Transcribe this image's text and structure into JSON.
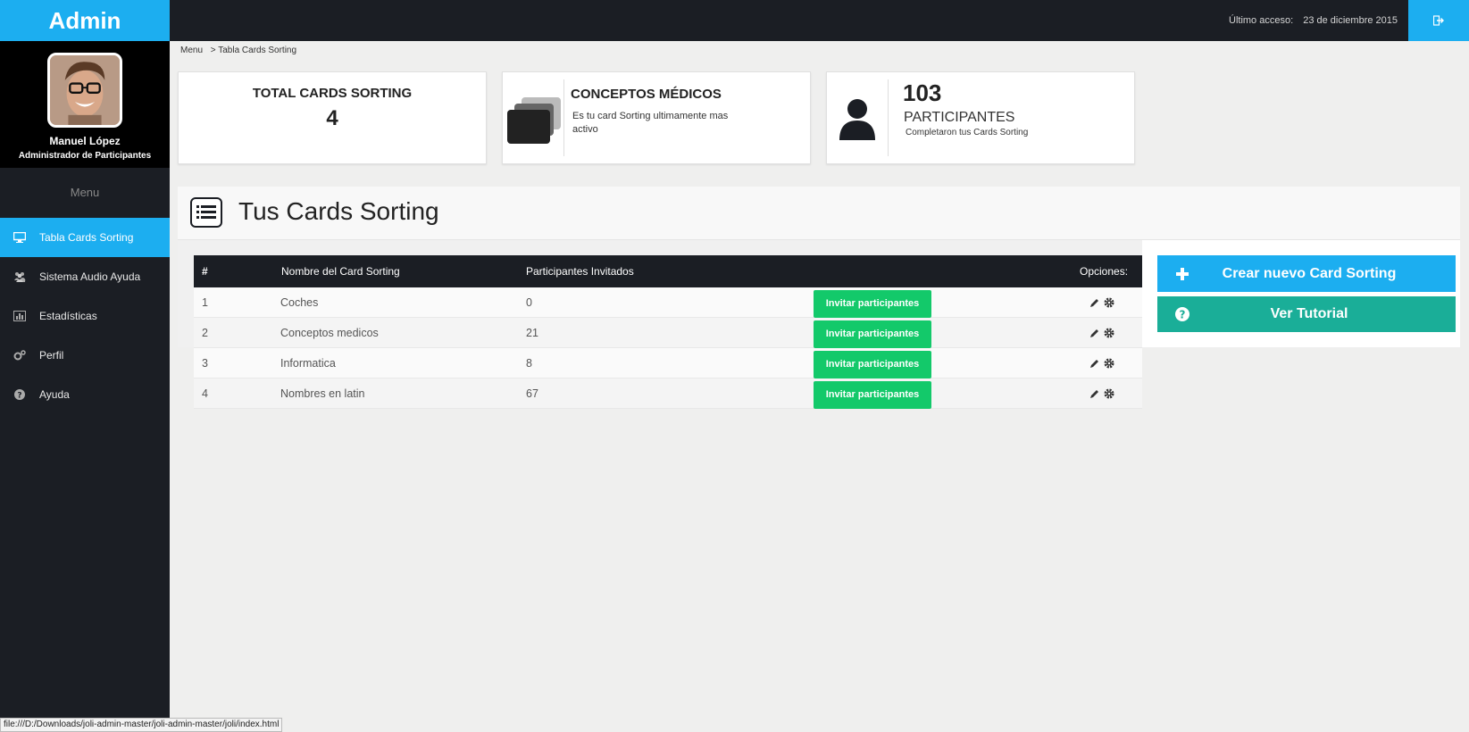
{
  "app": {
    "brand": "Admin"
  },
  "profile": {
    "name": "Manuel López",
    "role": "Administrador de Participantes"
  },
  "sidebar": {
    "menu_title": "Menu",
    "items": [
      {
        "label": "Tabla Cards Sorting",
        "icon": "monitor-icon",
        "active": true
      },
      {
        "label": "Sistema Audio Ayuda",
        "icon": "users-icon",
        "active": false
      },
      {
        "label": "Estadísticas",
        "icon": "bar-chart-icon",
        "active": false
      },
      {
        "label": "Perfil",
        "icon": "gears-icon",
        "active": false
      },
      {
        "label": "Ayuda",
        "icon": "question-circle-icon",
        "active": false
      }
    ]
  },
  "topbar": {
    "last_access_label": "Último acceso:",
    "last_access_value": "23 de diciembre 2015",
    "logout_icon": "sign-out-icon"
  },
  "breadcrumb": {
    "root": "Menu",
    "current": "> Tabla Cards Sorting"
  },
  "stats": {
    "total": {
      "title": "TOTAL CARDS SORTING",
      "value": "4"
    },
    "concept": {
      "title": "CONCEPTOS MÉDICOS",
      "desc": "Es tu card Sorting ultimamente mas activo"
    },
    "participants": {
      "value": "103",
      "label": "PARTICIPANTES",
      "sub": "Completaron tus Cards Sorting"
    }
  },
  "panel": {
    "title": "Tus Cards Sorting",
    "icon": "list-icon"
  },
  "table": {
    "headers": {
      "num": "#",
      "name": "Nombre del Card Sorting",
      "invited": "Participantes Invitados",
      "options": "Opciones:"
    },
    "invite_label": "Invitar participantes",
    "rows": [
      {
        "num": "1",
        "name": "Coches",
        "invited": "0"
      },
      {
        "num": "2",
        "name": "Conceptos medicos",
        "invited": "21"
      },
      {
        "num": "3",
        "name": "Informatica",
        "invited": "8"
      },
      {
        "num": "4",
        "name": "Nombres en latin",
        "invited": "67"
      }
    ]
  },
  "actions": {
    "create_label": "Crear nuevo Card Sorting",
    "tutorial_label": "Ver Tutorial"
  },
  "statusbar": {
    "url": "file:///D:/Downloads/joli-admin-master/joli-admin-master/joli/index.html"
  },
  "colors": {
    "accent": "#1caef0",
    "dark": "#1b1e24",
    "green": "#13c96a",
    "teal": "#1aae98"
  }
}
